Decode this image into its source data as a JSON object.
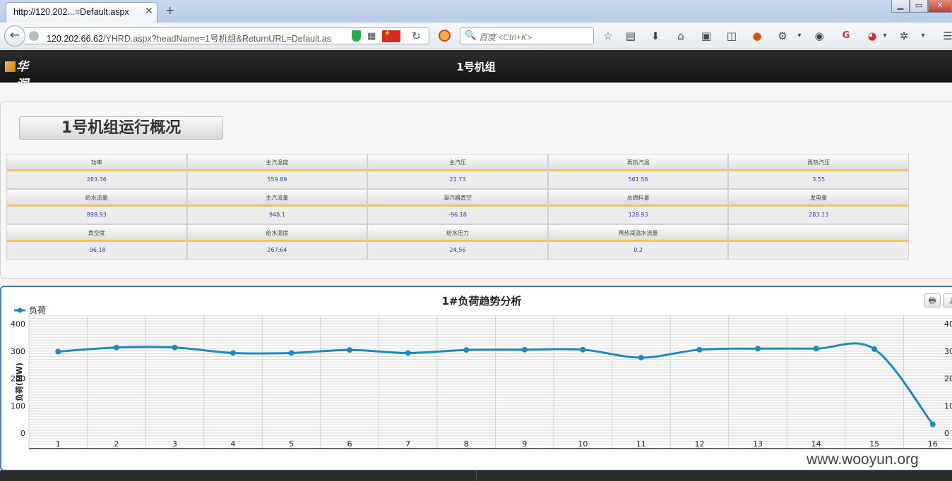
{
  "browser": {
    "tab_title": "http://120.202...=Default.aspx",
    "tab_close": "✕",
    "new_tab": "+",
    "url_host": "120.202.66.62",
    "url_path": "/YHRD.aspx?headName=1号机组&ReturnURL=Default.as",
    "search_placeholder": "百度 <Ctrl+K>",
    "win_minimize": "▁",
    "win_maximize": "▭",
    "win_close": "✕"
  },
  "header": {
    "logo_text": "华润",
    "title": "1号机组"
  },
  "overview": {
    "title": "1号机组运行概况",
    "rows": [
      [
        {
          "label": "功率",
          "value": "283.36"
        },
        {
          "label": "主汽温度",
          "value": "559.89"
        },
        {
          "label": "主汽压",
          "value": "21.73"
        },
        {
          "label": "再热汽温",
          "value": "561.56"
        },
        {
          "label": "再热汽压",
          "value": "3.55"
        }
      ],
      [
        {
          "label": "给水流量",
          "value": "898.93"
        },
        {
          "label": "主汽流量",
          "value": "948.1"
        },
        {
          "label": "凝汽器真空",
          "value": "-96.18"
        },
        {
          "label": "总燃料量",
          "value": "128.93"
        },
        {
          "label": "发电量",
          "value": "283.13"
        }
      ],
      [
        {
          "label": "真空度",
          "value": "-96.18"
        },
        {
          "label": "给水温度",
          "value": "267.64"
        },
        {
          "label": "给水压力",
          "value": "24.56"
        },
        {
          "label": "再热减温水流量",
          "value": "0.2"
        },
        {
          "label": "",
          "value": ""
        }
      ]
    ]
  },
  "chart": {
    "print_icon": "🖶",
    "export_icon": "⤓"
  },
  "chart_data": {
    "type": "line",
    "title": "1#负荷趋势分析",
    "xlabel": "",
    "ylabel": "负荷(MW)",
    "categories": [
      "1",
      "2",
      "3",
      "4",
      "5",
      "6",
      "7",
      "8",
      "9",
      "10",
      "11",
      "12",
      "13",
      "14",
      "15",
      "16"
    ],
    "yticks": [
      "0",
      "100",
      "200",
      "300",
      "400"
    ],
    "ylim": [
      0,
      400
    ],
    "grid": true,
    "legend": "top-left",
    "series": [
      {
        "name": "负荷",
        "color": "#1b8bbd",
        "values": [
          298,
          313,
          313,
          293,
          293,
          304,
          293,
          304,
          305,
          305,
          276,
          305,
          309,
          309,
          307,
          32
        ]
      }
    ]
  },
  "watermark": "www.wooyun.org"
}
